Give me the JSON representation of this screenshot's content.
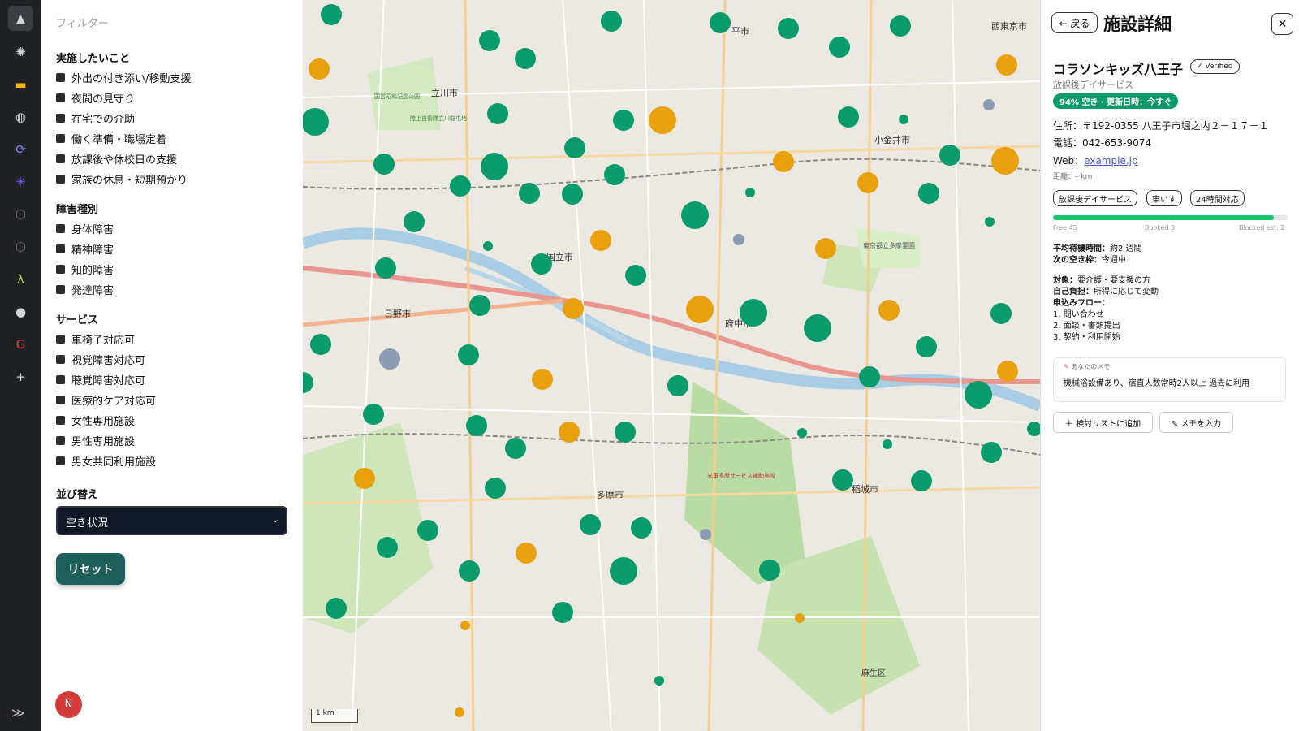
{
  "rail": {
    "items": [
      "logo-icon",
      "openai-icon",
      "slides-icon",
      "globe-icon",
      "sync-icon",
      "asterisk-icon",
      "hexagon-icon",
      "hexagon-icon",
      "lambda-icon",
      "github-icon",
      "google-icon",
      "plus-icon"
    ],
    "expand_label": "≫"
  },
  "filters": {
    "title": "フィルター",
    "groups": [
      {
        "title": "実施したいこと",
        "items": [
          "外出の付き添い/移動支援",
          "夜間の見守り",
          "在宅での介助",
          "働く準備・職場定着",
          "放課後や休校日の支援",
          "家族の休息・短期預かり"
        ]
      },
      {
        "title": "障害種別",
        "items": [
          "身体障害",
          "精神障害",
          "知的障害",
          "発達障害"
        ]
      },
      {
        "title": "サービス",
        "items": [
          "車椅子対応可",
          "視覚障害対応可",
          "聴覚障害対応可",
          "医療的ケア対応可",
          "女性専用施設",
          "男性専用施設",
          "男女共同利用施設"
        ]
      }
    ],
    "sort_title": "並び替え",
    "sort_value": "空き状況",
    "reset_label": "リセット"
  },
  "user": {
    "initial": "N"
  },
  "map": {
    "labels": [
      "立川市",
      "日野市",
      "国立市",
      "府中市",
      "多摩市",
      "小金井市",
      "稲城市",
      "西東京市",
      "平市",
      "麻生区",
      "東京都立多摩霊園",
      "国営昭和記念公園",
      "陸上自衛隊立川駐屯地",
      "米軍多摩サービス補助施設"
    ],
    "scale_label": "1 km",
    "colors": {
      "available": "#0a9b6c",
      "few": "#e8a00c",
      "unknown": "#8a9bb3"
    }
  },
  "detail": {
    "back_label": "← 戻る",
    "title": "施設詳細",
    "close_label": "✕",
    "facility_name": "コラソンキッズ八王子",
    "verified_label": "✓ Verified",
    "facility_type": "放課後デイサービス",
    "status": "94% 空き · 更新日時：今すぐ",
    "address": "住所：〒192-0355 八王子市堀之内２－１７－１",
    "phone": "電話：042-653-9074",
    "web_label": "Web：",
    "web_link": "example.jp",
    "distance": "距離：– km",
    "tags": [
      "放課後デイサービス",
      "車いす",
      "24時間対応"
    ],
    "capacity": {
      "free_label": "Free 45",
      "booked_label": "Booked 3",
      "blocked_label": "Blocked est. 2",
      "free_ratio": 0.94
    },
    "wait_key": "平均待機時間：",
    "wait_val": "約2 週間",
    "next_key": "次の空き枠：",
    "next_val": "今週中",
    "target_key": "対象：",
    "target_val": "要介護・要支援の方",
    "cost_key": "自己負担：",
    "cost_val": "所得に応じて変動",
    "flow_key": "申込みフロー：",
    "flow_steps": [
      "1. 問い合わせ",
      "2. 面談・書類提出",
      "3. 契約・利用開始"
    ],
    "memo_head": "あなたのメモ",
    "memo_text": "機械浴設備あり、宿直人数常時2人以上 過去に利用",
    "add_list_label": "＋ 検討リストに追加",
    "memo_btn_label": "✎ メモを入力"
  }
}
